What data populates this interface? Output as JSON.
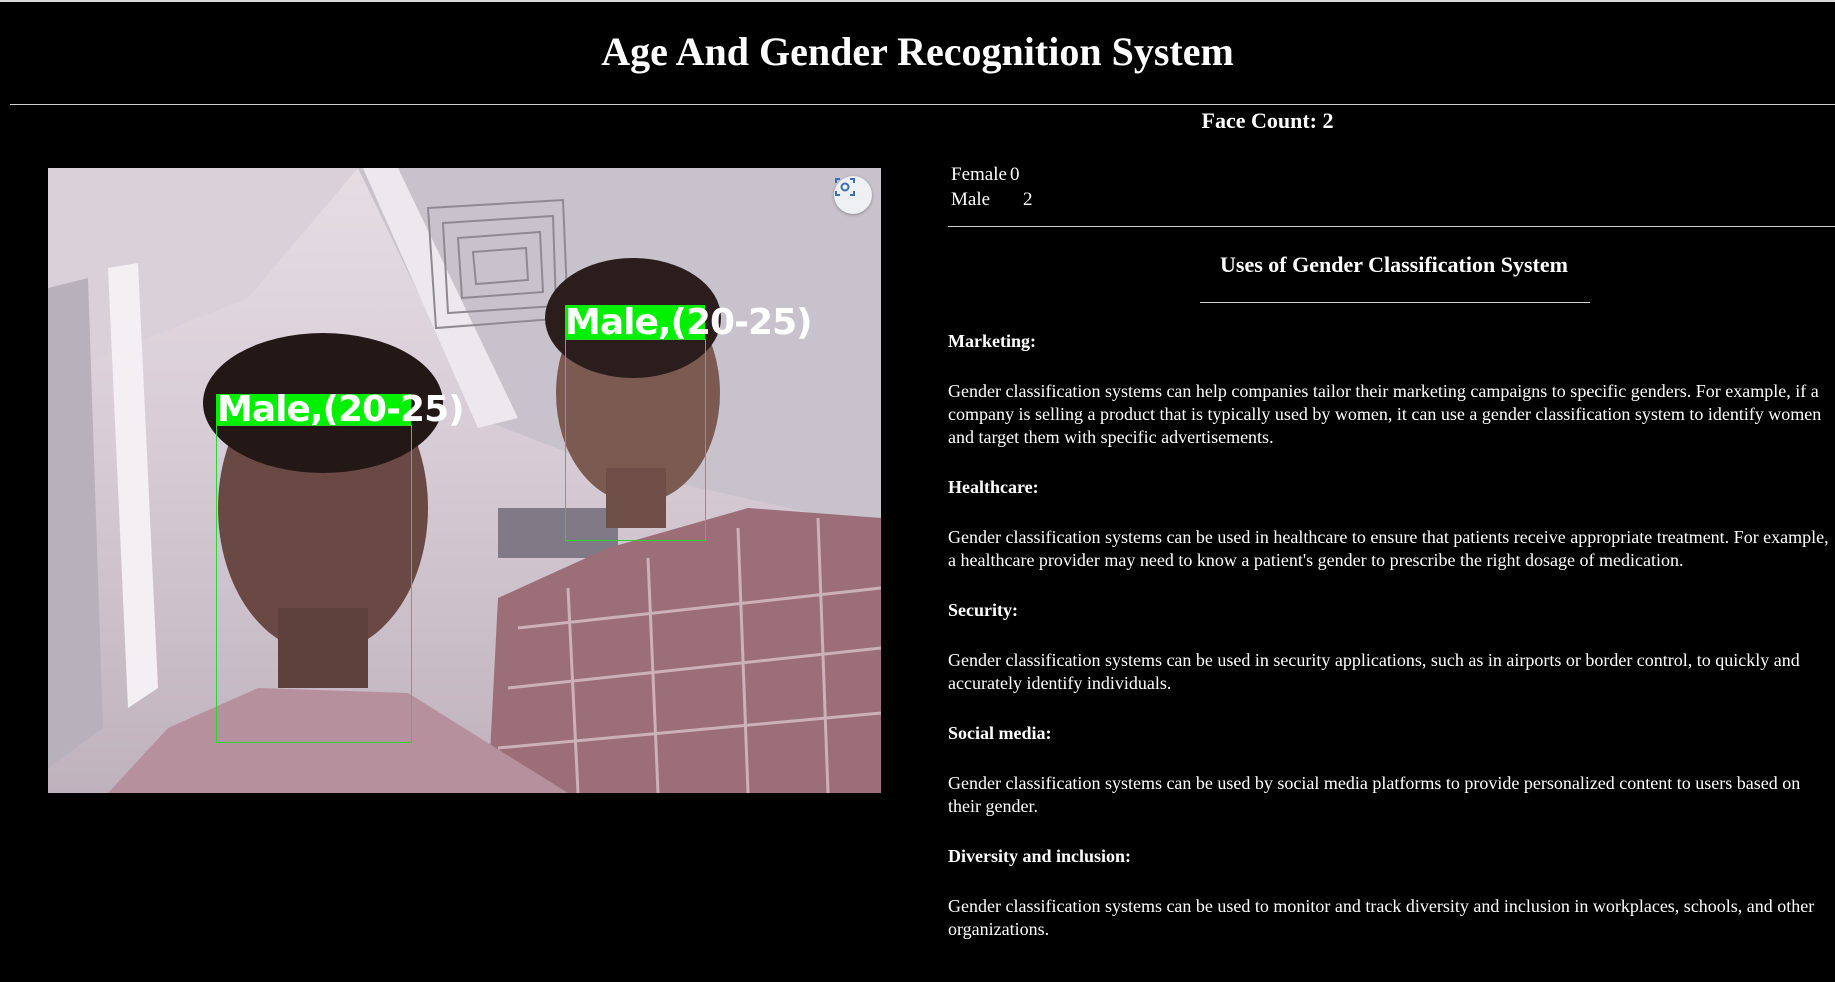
{
  "header": {
    "title": "Age And Gender Recognition System"
  },
  "camera": {
    "capture_icon": "screenshot-capture-icon",
    "detections": [
      {
        "label": "Male,(20-25)",
        "box_color": "#2cd62c",
        "label_bg": "#00f000"
      },
      {
        "label": "Male,(20-25)",
        "box_color": "#2cd62c",
        "label_bg": "#00f000"
      }
    ]
  },
  "stats": {
    "face_count": "Face Count: 2",
    "rows": [
      {
        "label": "Female",
        "value": "0"
      },
      {
        "label": "Male",
        "value": "2"
      }
    ]
  },
  "uses": {
    "heading": "Uses of Gender Classification System",
    "items": [
      {
        "title": "Marketing:",
        "text": "Gender classification systems can help companies tailor their marketing campaigns to specific genders. For example, if a company is selling a product that is typically used by women, it can use a gender classification system to identify women and target them with specific advertisements."
      },
      {
        "title": "Healthcare:",
        "text": "Gender classification systems can be used in healthcare to ensure that patients receive appropriate treatment. For example, a healthcare provider may need to know a patient's gender to prescribe the right dosage of medication."
      },
      {
        "title": "Security:",
        "text": "Gender classification systems can be used in security applications, such as in airports or border control, to quickly and accurately identify individuals."
      },
      {
        "title": "Social media:",
        "text": "Gender classification systems can be used by social media platforms to provide personalized content to users based on their gender."
      },
      {
        "title": "Diversity and inclusion:",
        "text": "Gender classification systems can be used to monitor and track diversity and inclusion in workplaces, schools, and other organizations."
      }
    ]
  }
}
